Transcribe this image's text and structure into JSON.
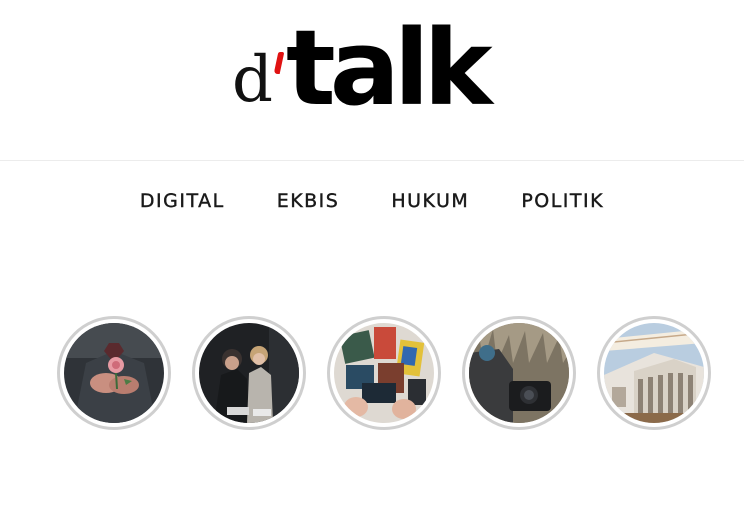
{
  "brand": {
    "logo_prefix": "d",
    "logo_name": "talk",
    "accent_color": "#e01212"
  },
  "nav": {
    "items": [
      {
        "label": "DIGITAL"
      },
      {
        "label": "EKBIS"
      },
      {
        "label": "HUKUM"
      },
      {
        "label": "POLITIK"
      }
    ]
  },
  "stories": [
    {
      "image": "hands-holding-rose"
    },
    {
      "image": "couple-sitting"
    },
    {
      "image": "books-and-magazines"
    },
    {
      "image": "camera-in-grass"
    },
    {
      "image": "government-building"
    }
  ]
}
